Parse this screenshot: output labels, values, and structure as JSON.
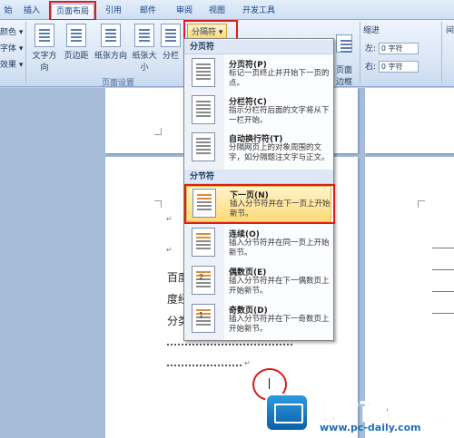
{
  "tabs": [
    {
      "label": "始",
      "active": false
    },
    {
      "label": "插入",
      "active": false
    },
    {
      "label": "页面布局",
      "active": true
    },
    {
      "label": "引用",
      "active": false
    },
    {
      "label": "邮件",
      "active": false
    },
    {
      "label": "审阅",
      "active": false
    },
    {
      "label": "视图",
      "active": false
    },
    {
      "label": "开发工具",
      "active": false
    }
  ],
  "ribbon": {
    "theme_items": [
      "颜色 ▾",
      "字体 ▾",
      "效果 ▾"
    ],
    "page_setup": {
      "buttons": [
        "文字方向",
        "页边距",
        "纸张方向",
        "纸张大小",
        "分栏"
      ],
      "group_label": "页面设置"
    },
    "breaks_button": "分隔符 ▾",
    "page_border": "页面\n边框",
    "indent": {
      "label": "缩进",
      "left_label": "左:",
      "left_value": "0 字符",
      "right_label": "右:",
      "right_value": "0 字符"
    },
    "spacing_label": "间"
  },
  "menu": {
    "page_breaks_header": "分页符",
    "section_breaks_header": "分节符",
    "items": [
      {
        "title": "分页符(P)",
        "desc": "标记一页终止并开始下一页的点。"
      },
      {
        "title": "分栏符(C)",
        "desc": "指示分栏符后面的文字将从下一栏开始。"
      },
      {
        "title": "自动换行符(T)",
        "desc": "分隔网页上的对象周围的文字，如分隔题注文字与正文。"
      },
      {
        "title": "下一页(N)",
        "desc": "插入分节符并在下一页上开始新节。"
      },
      {
        "title": "连续(O)",
        "desc": "插入分节符并在同一页上开始新节。"
      },
      {
        "title": "偶数页(E)",
        "desc": "插入分节符并在下一偶数页上开始新节。"
      },
      {
        "title": "奇数页(D)",
        "desc": "插入分节符并在下一奇数页上开始新节。"
      }
    ],
    "badges": {
      "even": "2",
      "odd": "1"
    }
  },
  "document": {
    "para_mark": "↵",
    "lines": [
      "百度",
      "度经",
      "分类"
    ]
  },
  "watermark": {
    "title": "电脑百科知识",
    "url": "www.pc-daily.com"
  },
  "colors": {
    "highlight_red": "#e01b1b",
    "selected_item": "#ffd978",
    "ribbon_bg": "#d7e4f4"
  }
}
